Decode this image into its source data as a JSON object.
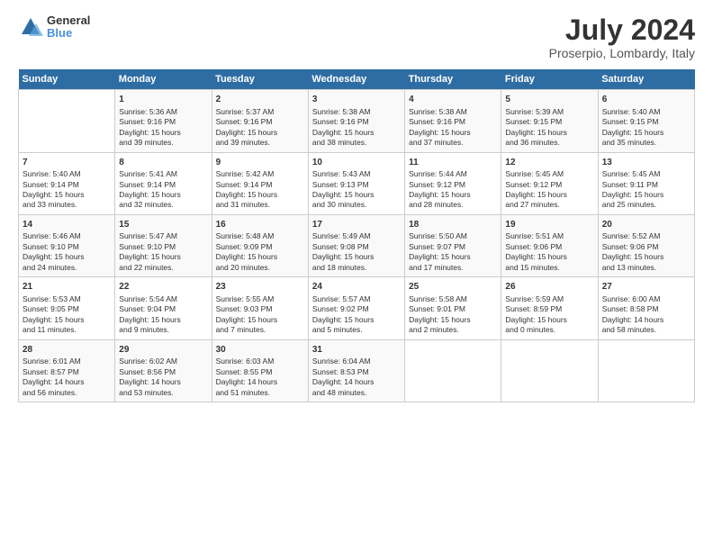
{
  "header": {
    "logo_line1": "General",
    "logo_line2": "Blue",
    "title": "July 2024",
    "subtitle": "Proserpio, Lombardy, Italy"
  },
  "calendar": {
    "days_of_week": [
      "Sunday",
      "Monday",
      "Tuesday",
      "Wednesday",
      "Thursday",
      "Friday",
      "Saturday"
    ],
    "weeks": [
      [
        {
          "day": "",
          "info": ""
        },
        {
          "day": "1",
          "info": "Sunrise: 5:36 AM\nSunset: 9:16 PM\nDaylight: 15 hours\nand 39 minutes."
        },
        {
          "day": "2",
          "info": "Sunrise: 5:37 AM\nSunset: 9:16 PM\nDaylight: 15 hours\nand 39 minutes."
        },
        {
          "day": "3",
          "info": "Sunrise: 5:38 AM\nSunset: 9:16 PM\nDaylight: 15 hours\nand 38 minutes."
        },
        {
          "day": "4",
          "info": "Sunrise: 5:38 AM\nSunset: 9:16 PM\nDaylight: 15 hours\nand 37 minutes."
        },
        {
          "day": "5",
          "info": "Sunrise: 5:39 AM\nSunset: 9:15 PM\nDaylight: 15 hours\nand 36 minutes."
        },
        {
          "day": "6",
          "info": "Sunrise: 5:40 AM\nSunset: 9:15 PM\nDaylight: 15 hours\nand 35 minutes."
        }
      ],
      [
        {
          "day": "7",
          "info": "Sunrise: 5:40 AM\nSunset: 9:14 PM\nDaylight: 15 hours\nand 33 minutes."
        },
        {
          "day": "8",
          "info": "Sunrise: 5:41 AM\nSunset: 9:14 PM\nDaylight: 15 hours\nand 32 minutes."
        },
        {
          "day": "9",
          "info": "Sunrise: 5:42 AM\nSunset: 9:14 PM\nDaylight: 15 hours\nand 31 minutes."
        },
        {
          "day": "10",
          "info": "Sunrise: 5:43 AM\nSunset: 9:13 PM\nDaylight: 15 hours\nand 30 minutes."
        },
        {
          "day": "11",
          "info": "Sunrise: 5:44 AM\nSunset: 9:12 PM\nDaylight: 15 hours\nand 28 minutes."
        },
        {
          "day": "12",
          "info": "Sunrise: 5:45 AM\nSunset: 9:12 PM\nDaylight: 15 hours\nand 27 minutes."
        },
        {
          "day": "13",
          "info": "Sunrise: 5:45 AM\nSunset: 9:11 PM\nDaylight: 15 hours\nand 25 minutes."
        }
      ],
      [
        {
          "day": "14",
          "info": "Sunrise: 5:46 AM\nSunset: 9:10 PM\nDaylight: 15 hours\nand 24 minutes."
        },
        {
          "day": "15",
          "info": "Sunrise: 5:47 AM\nSunset: 9:10 PM\nDaylight: 15 hours\nand 22 minutes."
        },
        {
          "day": "16",
          "info": "Sunrise: 5:48 AM\nSunset: 9:09 PM\nDaylight: 15 hours\nand 20 minutes."
        },
        {
          "day": "17",
          "info": "Sunrise: 5:49 AM\nSunset: 9:08 PM\nDaylight: 15 hours\nand 18 minutes."
        },
        {
          "day": "18",
          "info": "Sunrise: 5:50 AM\nSunset: 9:07 PM\nDaylight: 15 hours\nand 17 minutes."
        },
        {
          "day": "19",
          "info": "Sunrise: 5:51 AM\nSunset: 9:06 PM\nDaylight: 15 hours\nand 15 minutes."
        },
        {
          "day": "20",
          "info": "Sunrise: 5:52 AM\nSunset: 9:06 PM\nDaylight: 15 hours\nand 13 minutes."
        }
      ],
      [
        {
          "day": "21",
          "info": "Sunrise: 5:53 AM\nSunset: 9:05 PM\nDaylight: 15 hours\nand 11 minutes."
        },
        {
          "day": "22",
          "info": "Sunrise: 5:54 AM\nSunset: 9:04 PM\nDaylight: 15 hours\nand 9 minutes."
        },
        {
          "day": "23",
          "info": "Sunrise: 5:55 AM\nSunset: 9:03 PM\nDaylight: 15 hours\nand 7 minutes."
        },
        {
          "day": "24",
          "info": "Sunrise: 5:57 AM\nSunset: 9:02 PM\nDaylight: 15 hours\nand 5 minutes."
        },
        {
          "day": "25",
          "info": "Sunrise: 5:58 AM\nSunset: 9:01 PM\nDaylight: 15 hours\nand 2 minutes."
        },
        {
          "day": "26",
          "info": "Sunrise: 5:59 AM\nSunset: 8:59 PM\nDaylight: 15 hours\nand 0 minutes."
        },
        {
          "day": "27",
          "info": "Sunrise: 6:00 AM\nSunset: 8:58 PM\nDaylight: 14 hours\nand 58 minutes."
        }
      ],
      [
        {
          "day": "28",
          "info": "Sunrise: 6:01 AM\nSunset: 8:57 PM\nDaylight: 14 hours\nand 56 minutes."
        },
        {
          "day": "29",
          "info": "Sunrise: 6:02 AM\nSunset: 8:56 PM\nDaylight: 14 hours\nand 53 minutes."
        },
        {
          "day": "30",
          "info": "Sunrise: 6:03 AM\nSunset: 8:55 PM\nDaylight: 14 hours\nand 51 minutes."
        },
        {
          "day": "31",
          "info": "Sunrise: 6:04 AM\nSunset: 8:53 PM\nDaylight: 14 hours\nand 48 minutes."
        },
        {
          "day": "",
          "info": ""
        },
        {
          "day": "",
          "info": ""
        },
        {
          "day": "",
          "info": ""
        }
      ]
    ]
  }
}
